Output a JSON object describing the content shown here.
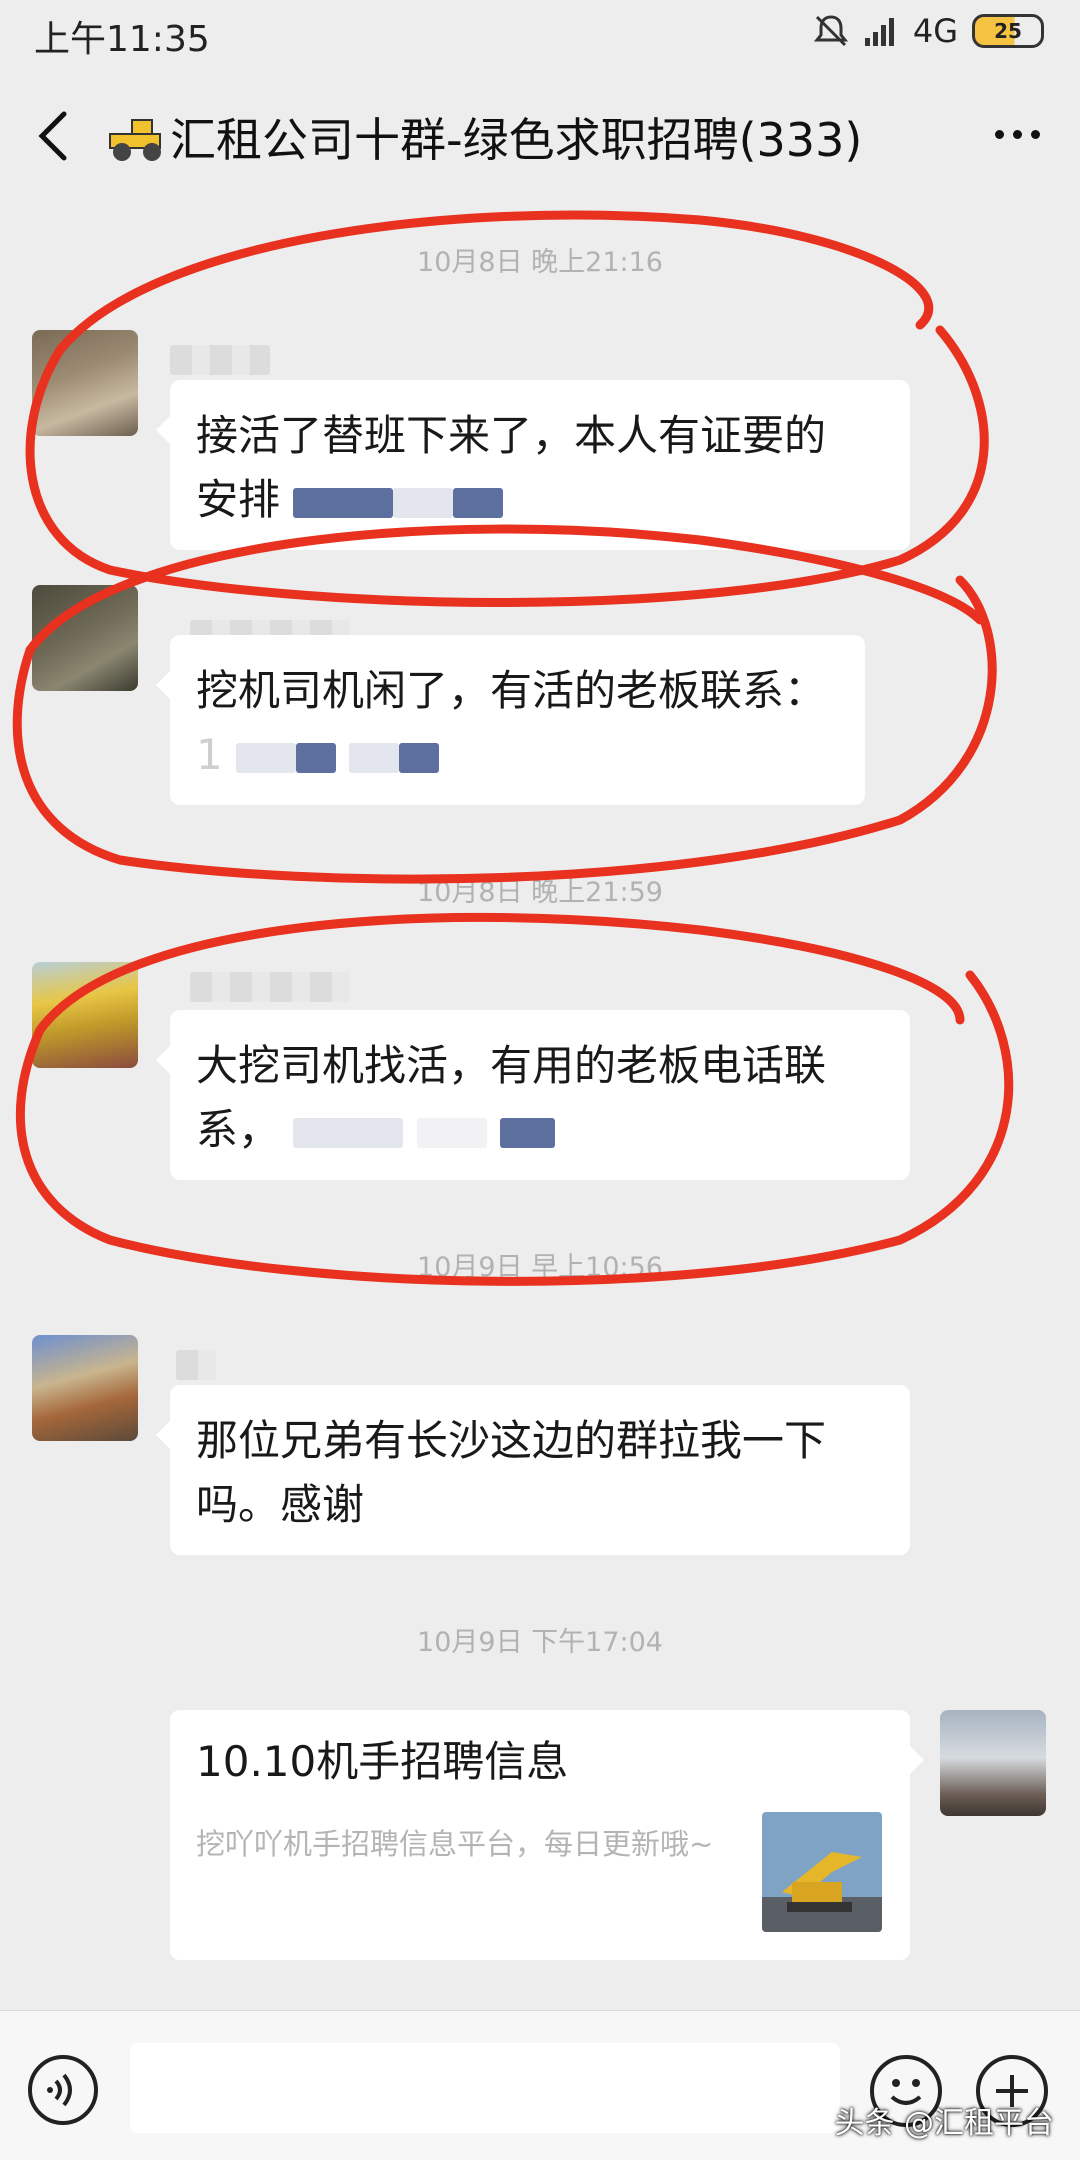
{
  "status_bar": {
    "time": "上午11:35",
    "network": "4G",
    "battery": "25"
  },
  "header": {
    "title": "汇租公司十群-绿色求职招聘(333)"
  },
  "messages": [
    {
      "timestamp": "10月8日 晚上21:16",
      "text_line1": "接活了替班下来了，本人有证要的",
      "text_line2": "安排"
    },
    {
      "text_line1": "挖机司机闲了，有活的老板联系：",
      "text_line2": "1"
    },
    {
      "timestamp": "10月8日 晚上21:59",
      "text_line1": "大挖司机找活，有用的老板电话联",
      "text_line2": "系，"
    },
    {
      "timestamp": "10月9日 早上10:56",
      "text_line1": "那位兄弟有长沙这边的群拉我一下",
      "text_line2": "吗。感谢"
    },
    {
      "timestamp": "10月9日 下午17:04",
      "card_title": "10.10机手招聘信息",
      "card_desc": "挖吖吖机手招聘信息平台，每日更新哦~"
    }
  ],
  "watermark": "头条 @汇租平台",
  "colors": {
    "background": "#ededed",
    "bubble": "#ffffff",
    "annotation": "#e8311f"
  }
}
